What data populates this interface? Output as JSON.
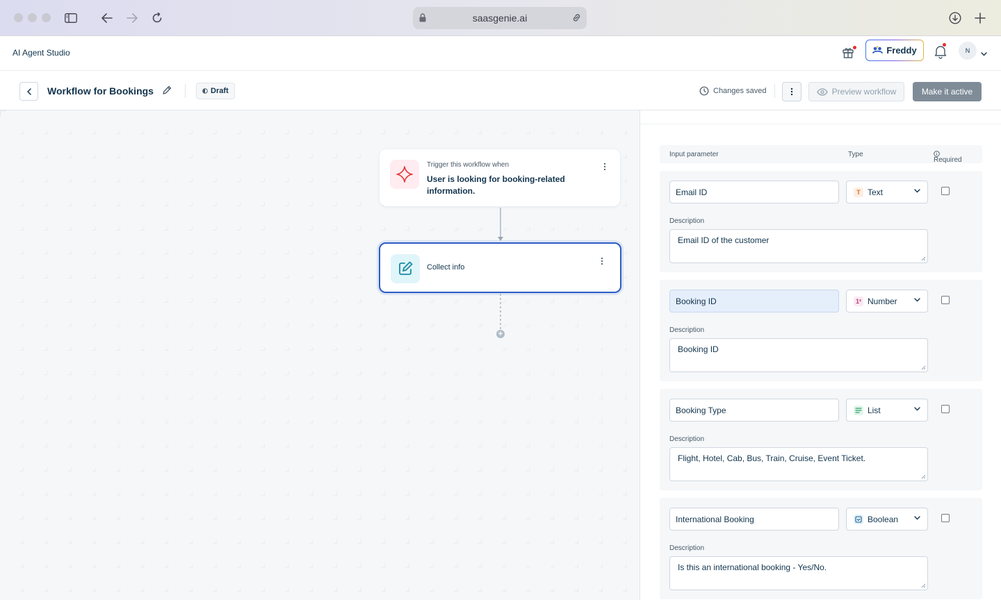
{
  "browser": {
    "url": "saasgenie.ai"
  },
  "app": {
    "title": "AI Agent Studio",
    "freddy_label": "Freddy",
    "avatar_initial": "N"
  },
  "toolbar": {
    "workflow_title": "Workflow for Bookings",
    "status_badge": "Draft",
    "saved_status": "Changes saved",
    "preview_label": "Preview workflow",
    "activate_label": "Make it active"
  },
  "canvas": {
    "trigger": {
      "subtitle": "Trigger this workflow when",
      "text": "User is looking for booking-related information."
    },
    "collect": {
      "label": "Collect info"
    }
  },
  "panel": {
    "headers": {
      "input_parameter": "Input parameter",
      "type": "Type",
      "required": "Required"
    },
    "description_label": "Description",
    "params": [
      {
        "name": "Email ID",
        "type": "Text",
        "type_icon": "text-type-icon",
        "description": "Email ID of the customer",
        "required": false
      },
      {
        "name": "Booking ID",
        "type": "Number",
        "type_icon": "number-type-icon",
        "description": "Booking ID",
        "required": false
      },
      {
        "name": "Booking Type",
        "type": "List",
        "type_icon": "list-type-icon",
        "description": "Flight, Hotel, Cab, Bus, Train, Cruise, Event Ticket.",
        "required": false
      },
      {
        "name": "International Booking",
        "type": "Boolean",
        "type_icon": "boolean-type-icon",
        "description": "Is this an international booking - Yes/No.",
        "required": false
      }
    ]
  },
  "colors": {
    "primary_blue": "#2c5cc5",
    "trigger_icon": "#e43538",
    "collect_icon": "#1a8aa3",
    "notification_dot": "#e4312c"
  }
}
